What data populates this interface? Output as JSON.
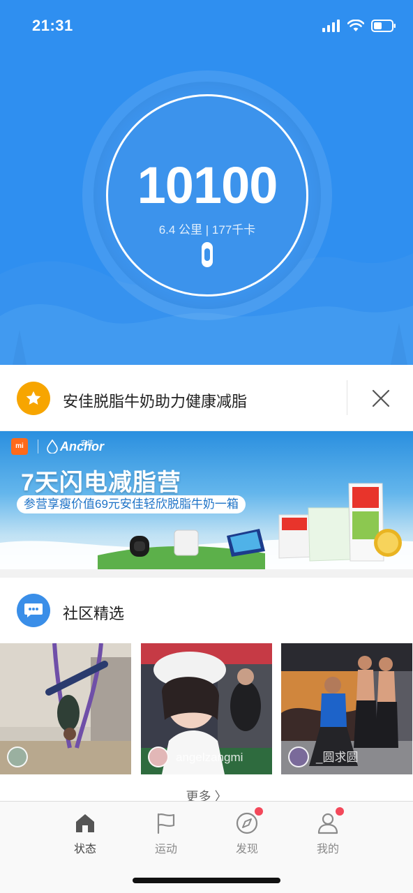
{
  "status_bar": {
    "time": "21:31"
  },
  "hero": {
    "steps": "10100",
    "summary": "6.4 公里 | 177千卡",
    "colors": {
      "background": "#2f8ff0",
      "ring": "#ffffff"
    }
  },
  "ad_row": {
    "title": "安佳脱脂牛奶助力健康减脂",
    "icon": "star-icon",
    "close_icon": "close-icon"
  },
  "banner": {
    "mi_badge": "mi",
    "brand": "Anchor",
    "brand_cn": "安佳",
    "title": "7天闪电减脂营",
    "subtitle": "参营享瘦价值69元安佳轻欣脱脂牛奶一箱"
  },
  "community": {
    "title": "社区精选",
    "icon": "chat-bubble-icon",
    "posts": [
      {
        "user": ""
      },
      {
        "user": "angelzangmi"
      },
      {
        "user": "_圆求圆"
      }
    ],
    "more": "更多 〉"
  },
  "tabbar": {
    "tabs": [
      {
        "label": "状态",
        "icon": "home-icon",
        "active": true,
        "badge": false
      },
      {
        "label": "运动",
        "icon": "flag-icon",
        "active": false,
        "badge": false
      },
      {
        "label": "发现",
        "icon": "compass-icon",
        "active": false,
        "badge": true
      },
      {
        "label": "我的",
        "icon": "person-icon",
        "active": false,
        "badge": true
      }
    ]
  }
}
